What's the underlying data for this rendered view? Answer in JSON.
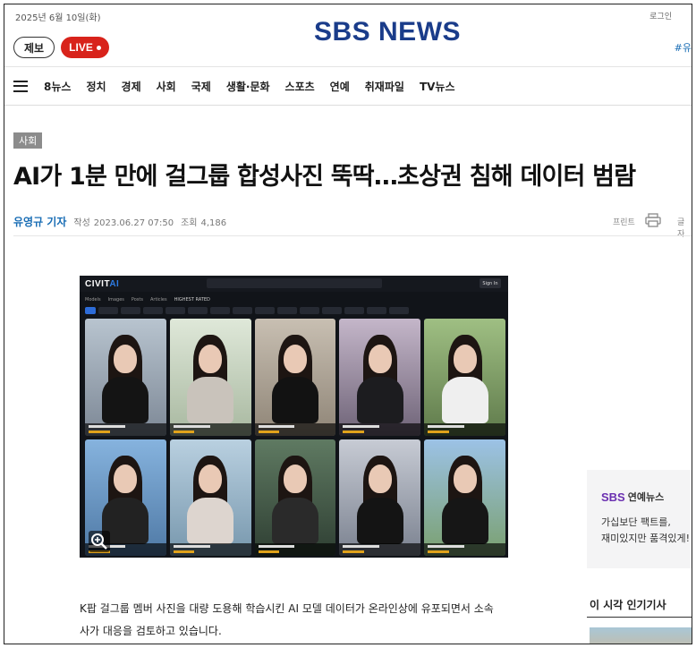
{
  "top": {
    "date": "2025년 6월 10일(화)",
    "login": "로그인",
    "logo": "SBS NEWS",
    "hashtag": "#유"
  },
  "buttons": {
    "jebo": "제보",
    "live": "LIVE"
  },
  "nav": {
    "items": [
      "8뉴스",
      "정치",
      "경제",
      "사회",
      "국제",
      "생활·문화",
      "스포츠",
      "연예",
      "취재파일",
      "TV뉴스"
    ]
  },
  "article": {
    "category": "사회",
    "headline": "AI가 1분 만에 걸그룹 합성사진 뚝딱…초상권 침해 데이터 범람",
    "reporter": "유영규 기자",
    "written_label": "작성",
    "written_time": "2023.06.27 07:50",
    "views_label": "조회",
    "views": "4,186",
    "print_label": "프린트",
    "share_label": "글자",
    "body_line1": "K팝 걸그룹 멤버 사진을 대량 도용해 학습시킨 AI 모델 데이터가 온라인상에 유포되면서 소속",
    "body_line2": "사가 대응을 검토하고 있습니다."
  },
  "image": {
    "site_logo_a": "CIVIT",
    "site_logo_b": "AI",
    "signin": "Sign In",
    "tabs": [
      "Models",
      "Images",
      "Posts",
      "Articles",
      "HIGHEST RATED"
    ],
    "icons": [
      "zoom-icon"
    ]
  },
  "sidebar": {
    "promo_brand": "SBS",
    "promo_section": "연예뉴스",
    "promo_line1": "가십보단 팩트를,",
    "promo_line2": "재미있지만 품격있게!",
    "popular_title": "이 시각 인기기사"
  },
  "colors": {
    "logo": "#1a3c8a",
    "live": "#d8231b",
    "reporter": "#1a6eb5",
    "category_bg": "#8c8c8c",
    "promo_brand": "#6a2fb0"
  }
}
